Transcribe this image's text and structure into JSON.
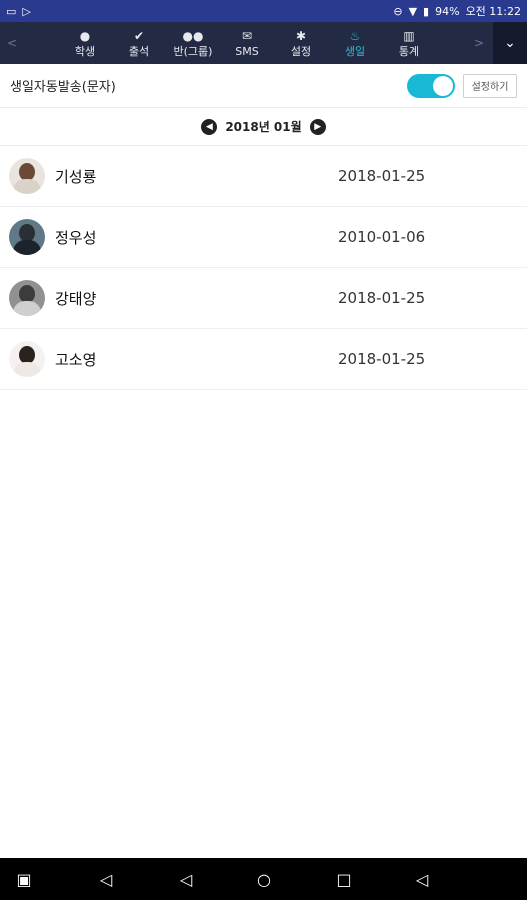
{
  "status": {
    "battery": "94%",
    "time": "오전 11:22"
  },
  "tabs": [
    {
      "label": "학생",
      "icon": "person-icon",
      "glyph": "●"
    },
    {
      "label": "출석",
      "icon": "check-circle-icon",
      "glyph": "✔"
    },
    {
      "label": "반(그룹)",
      "icon": "group-icon",
      "glyph": "●●"
    },
    {
      "label": "SMS",
      "icon": "mail-icon",
      "glyph": "✉"
    },
    {
      "label": "설정",
      "icon": "gear-icon",
      "glyph": "✱"
    },
    {
      "label": "생일",
      "icon": "cake-icon",
      "glyph": "♨",
      "active": true
    },
    {
      "label": "통계",
      "icon": "bar-chart-icon",
      "glyph": "▥"
    }
  ],
  "setting": {
    "title": "생일자동발송(문자)",
    "toggle_on": true,
    "button_label": "설정하기"
  },
  "month": {
    "label": "2018년 01월"
  },
  "students": [
    {
      "name": "기성룡",
      "date": "2018-01-25"
    },
    {
      "name": "정우성",
      "date": "2010-01-06"
    },
    {
      "name": "강태양",
      "date": "2018-01-25"
    },
    {
      "name": "고소영",
      "date": "2018-01-25"
    }
  ],
  "colors": {
    "accent": "#18b9d4",
    "nav_bg": "#222a44",
    "status_bg": "#2a3a8e"
  }
}
